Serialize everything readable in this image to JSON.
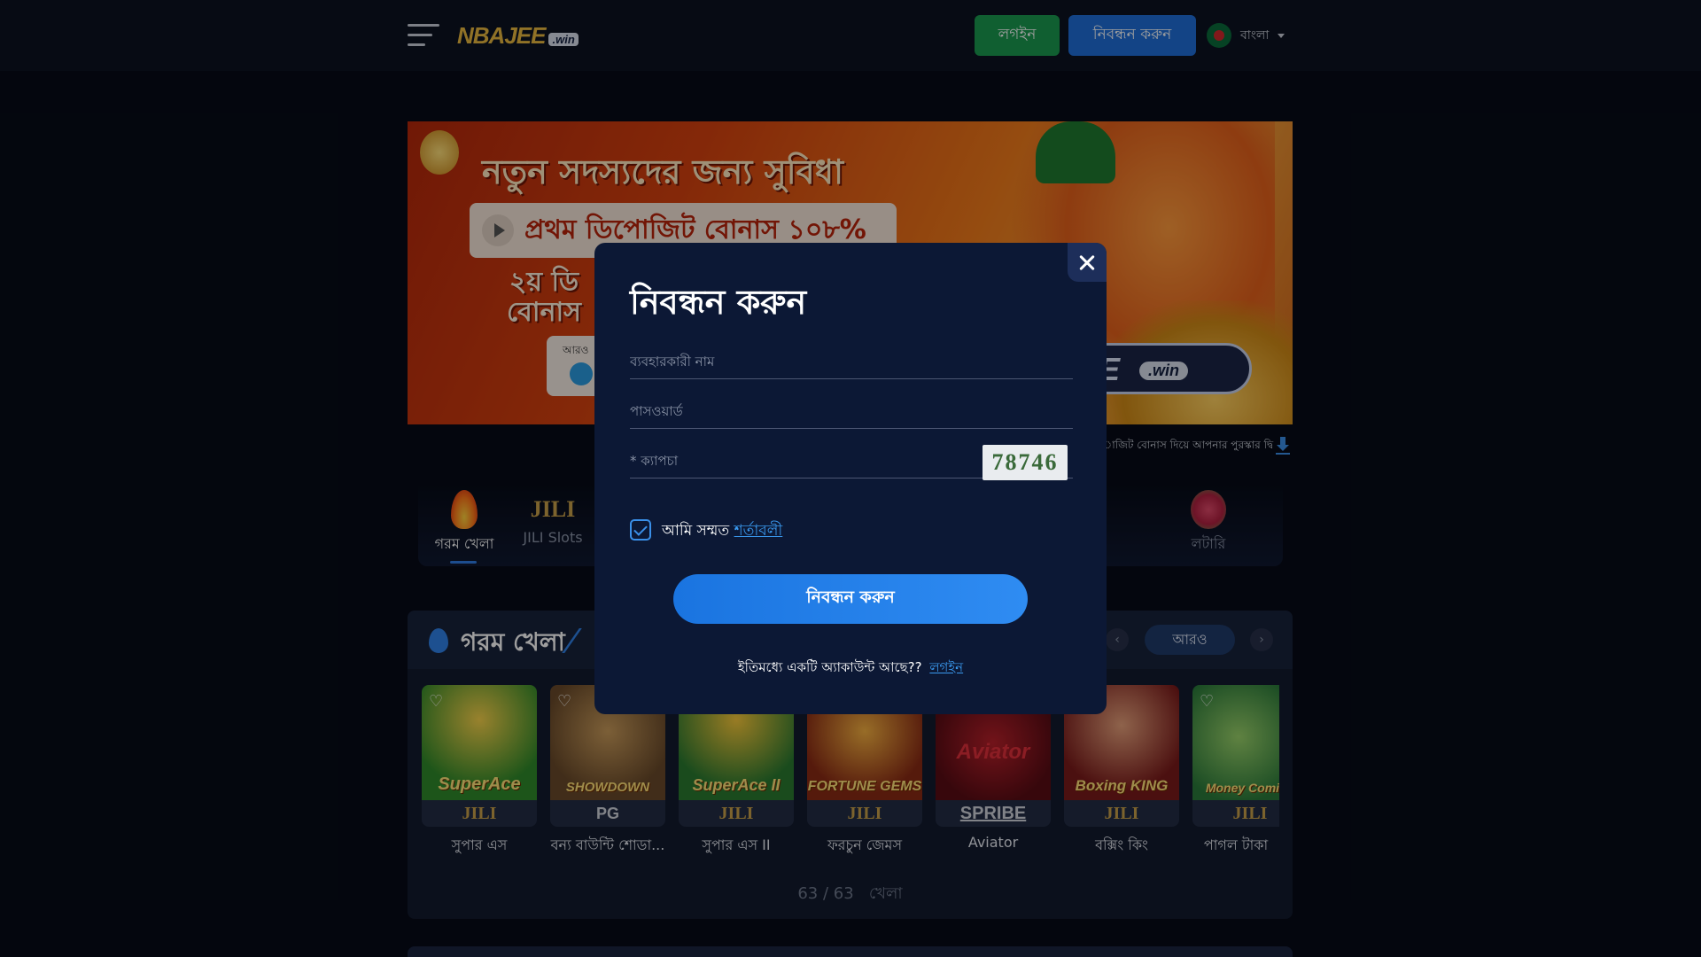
{
  "header": {
    "logo_text": "NBAJEE",
    "logo_badge": ".win",
    "login_label": "লগইন",
    "register_label": "নিবন্ধন করুন",
    "language": "বাংলা"
  },
  "banner": {
    "title": "নতুন সদস্যদের জন্য সুবিধা",
    "pill": "প্রথম ডিপোজিট বোনাস ১০৮%",
    "sub_line1": "২য় ডি",
    "sub_line2": "বোনাস",
    "card_text": "আরও",
    "logo_text": "JEE",
    "logo_badge": ".win"
  },
  "marquee": "াজিট বোনাস দিয়ে আপনার পুরস্কার দ্বি",
  "categories": [
    {
      "label": "গরম খেলা",
      "icon": "flame-icon"
    },
    {
      "label": "JILI Slots",
      "icon": "jili-logo",
      "logo": "JILI"
    },
    {
      "label": "লটারি",
      "icon": "lottery-icon"
    }
  ],
  "hot_section": {
    "title": "গরম খেলা",
    "prev": "‹",
    "next": "›",
    "more_label": "আরও",
    "count_text": "63 / 63",
    "count_suffix": "খেলা"
  },
  "games": [
    {
      "thumb_text": "SuperAce",
      "provider": "JILI",
      "name": "সুপার এস",
      "color": "#2f8a2a"
    },
    {
      "thumb_text": "SHOWDOWN",
      "provider": "PG",
      "name": "বন্য বাউন্টি শোডা...",
      "color": "#6a4a2a"
    },
    {
      "thumb_text": "SuperAce II",
      "provider": "JILI",
      "name": "সুপার এস II",
      "color": "#2a7a30"
    },
    {
      "thumb_text": "FORTUNE GEMS",
      "provider": "JILI",
      "name": "ফরচুন জেমস",
      "color": "#8a2a14"
    },
    {
      "thumb_text": "Aviator",
      "provider": "SPRIBE",
      "name": "Aviator",
      "color": "#5a0c14"
    },
    {
      "thumb_text": "Boxing KING",
      "provider": "JILI",
      "name": "বক্সিং কিং",
      "color": "#7a1a1a"
    },
    {
      "thumb_text": "Money Coming",
      "provider": "JILI",
      "name": "পাগল টাকা",
      "color": "#2a7a3a"
    }
  ],
  "modal": {
    "title": "নিবন্ধন করুন",
    "username_placeholder": "ব্যবহারকারী নাম",
    "password_placeholder": "পাসওয়ার্ড",
    "captcha_placeholder": "* ক্যাপচা",
    "captcha_code": "78746",
    "agree_text": "আমি সম্মত",
    "terms_label": "শর্তাবলী",
    "submit_label": "নিবন্ধন করুন",
    "already_text": "ইতিমধ্যে একটি অ্যাকাউন্ট আছে??",
    "login_link": "লগইন"
  },
  "colors": {
    "accent": "#1f6fd8",
    "login_green": "#1a9a4f",
    "modal_bg": "#0c1835"
  }
}
